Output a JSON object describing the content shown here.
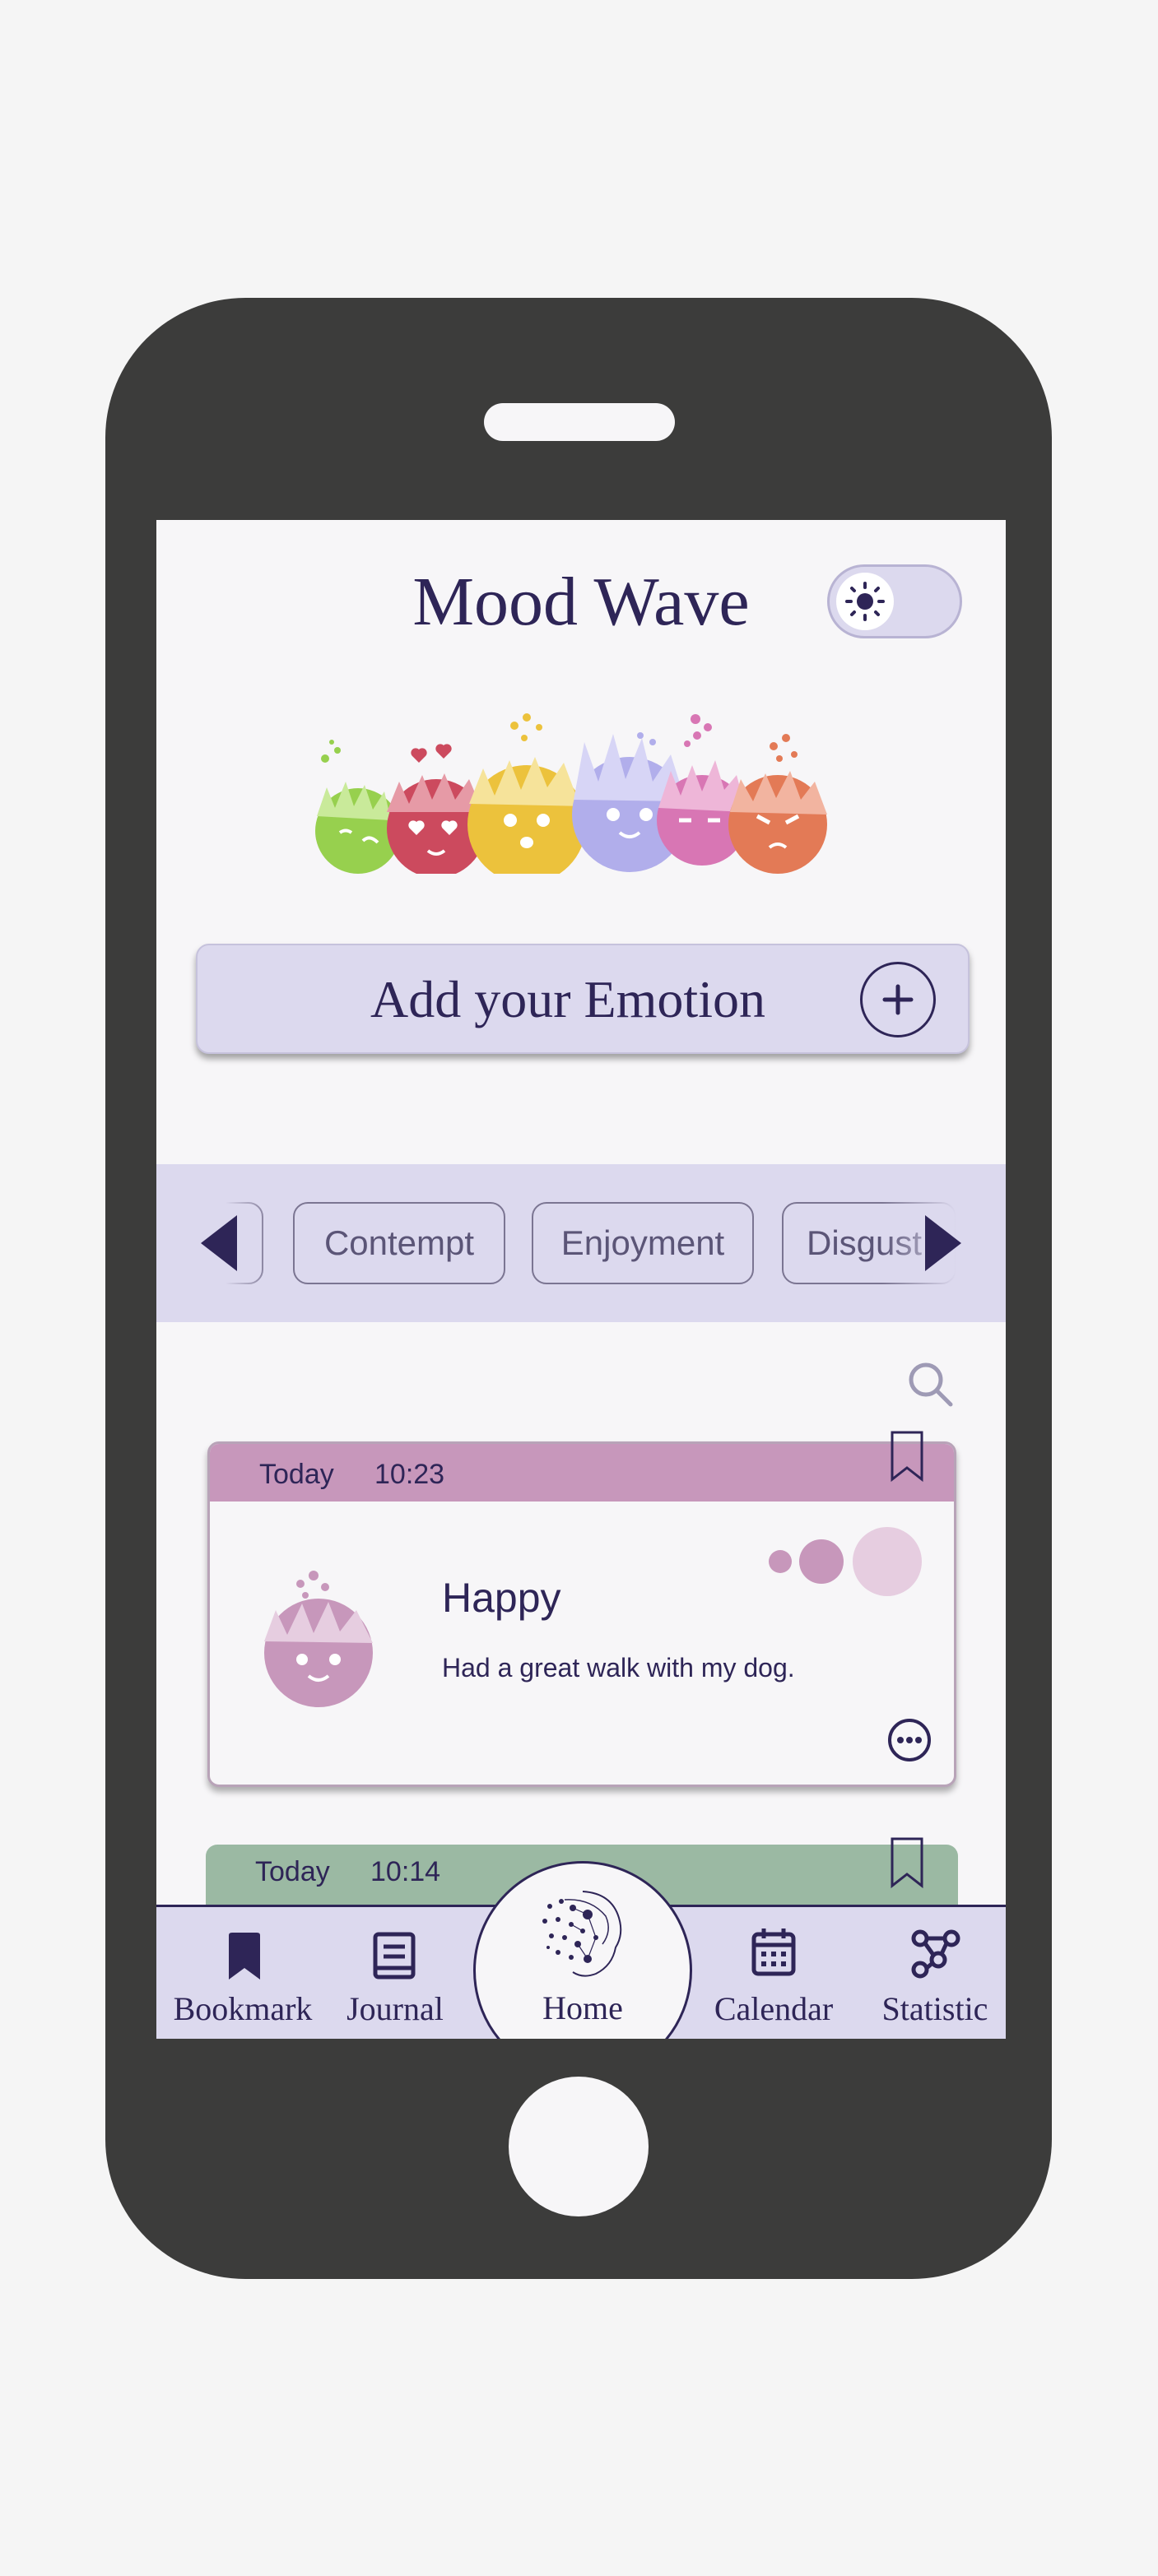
{
  "app": {
    "title": "Mood Wave"
  },
  "theme_toggle": {
    "icon": "sun-icon",
    "state": "light"
  },
  "add_emotion": {
    "label": "Add your Emotion",
    "icon": "plus-icon"
  },
  "filters": {
    "chips": [
      "Contempt",
      "Enjoyment",
      "Disgust"
    ],
    "prev_icon": "triangle-left-icon",
    "next_icon": "triangle-right-icon"
  },
  "search": {
    "icon": "search-icon"
  },
  "entries": [
    {
      "date": "Today",
      "time": "10:23",
      "mood": "Happy",
      "note": "Had a great walk with my dog.",
      "color": "#c797bb"
    },
    {
      "date": "Today",
      "time": "10:14",
      "color": "#9bb9a3"
    }
  ],
  "tabs": [
    {
      "label": "Bookmark",
      "icon": "bookmark-icon"
    },
    {
      "label": "Journal",
      "icon": "book-icon"
    },
    {
      "label": "Home",
      "icon": "head-network-icon"
    },
    {
      "label": "Calendar",
      "icon": "calendar-icon"
    },
    {
      "label": "Statistic",
      "icon": "share-nodes-icon"
    }
  ],
  "colors": {
    "brand": "#2e2557",
    "lavender": "#dcd9ee",
    "happy": "#c797bb",
    "green_entry": "#9bb9a3"
  }
}
